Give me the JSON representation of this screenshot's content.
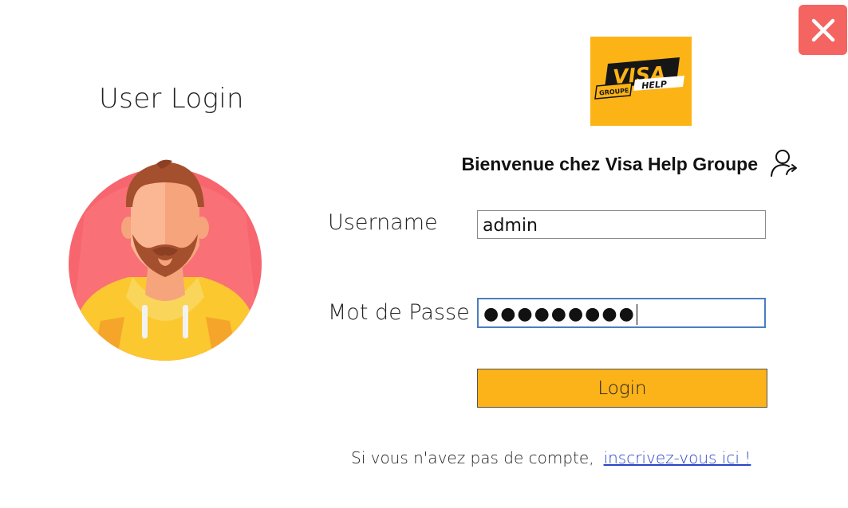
{
  "window": {
    "title": "User Login"
  },
  "logo": {
    "brand_word": "VISA",
    "sub_word": "HELP",
    "tag_word": "GROUPE",
    "bg_color": "#fcb316"
  },
  "welcome": {
    "text": "Bienvenue chez Visa Help Groupe",
    "icon": "user-arrow-icon"
  },
  "form": {
    "username_label": "Username",
    "username_value": "admin",
    "password_label": "Mot de Passe",
    "password_value": "●●●●●●●●●",
    "login_label": "Login"
  },
  "footer": {
    "text": "Si vous n'avez pas de compte,",
    "link": "inscrivez-vous ici !"
  },
  "colors": {
    "accent": "#fcb31a",
    "close": "#f46461",
    "link": "#2a43c5"
  }
}
